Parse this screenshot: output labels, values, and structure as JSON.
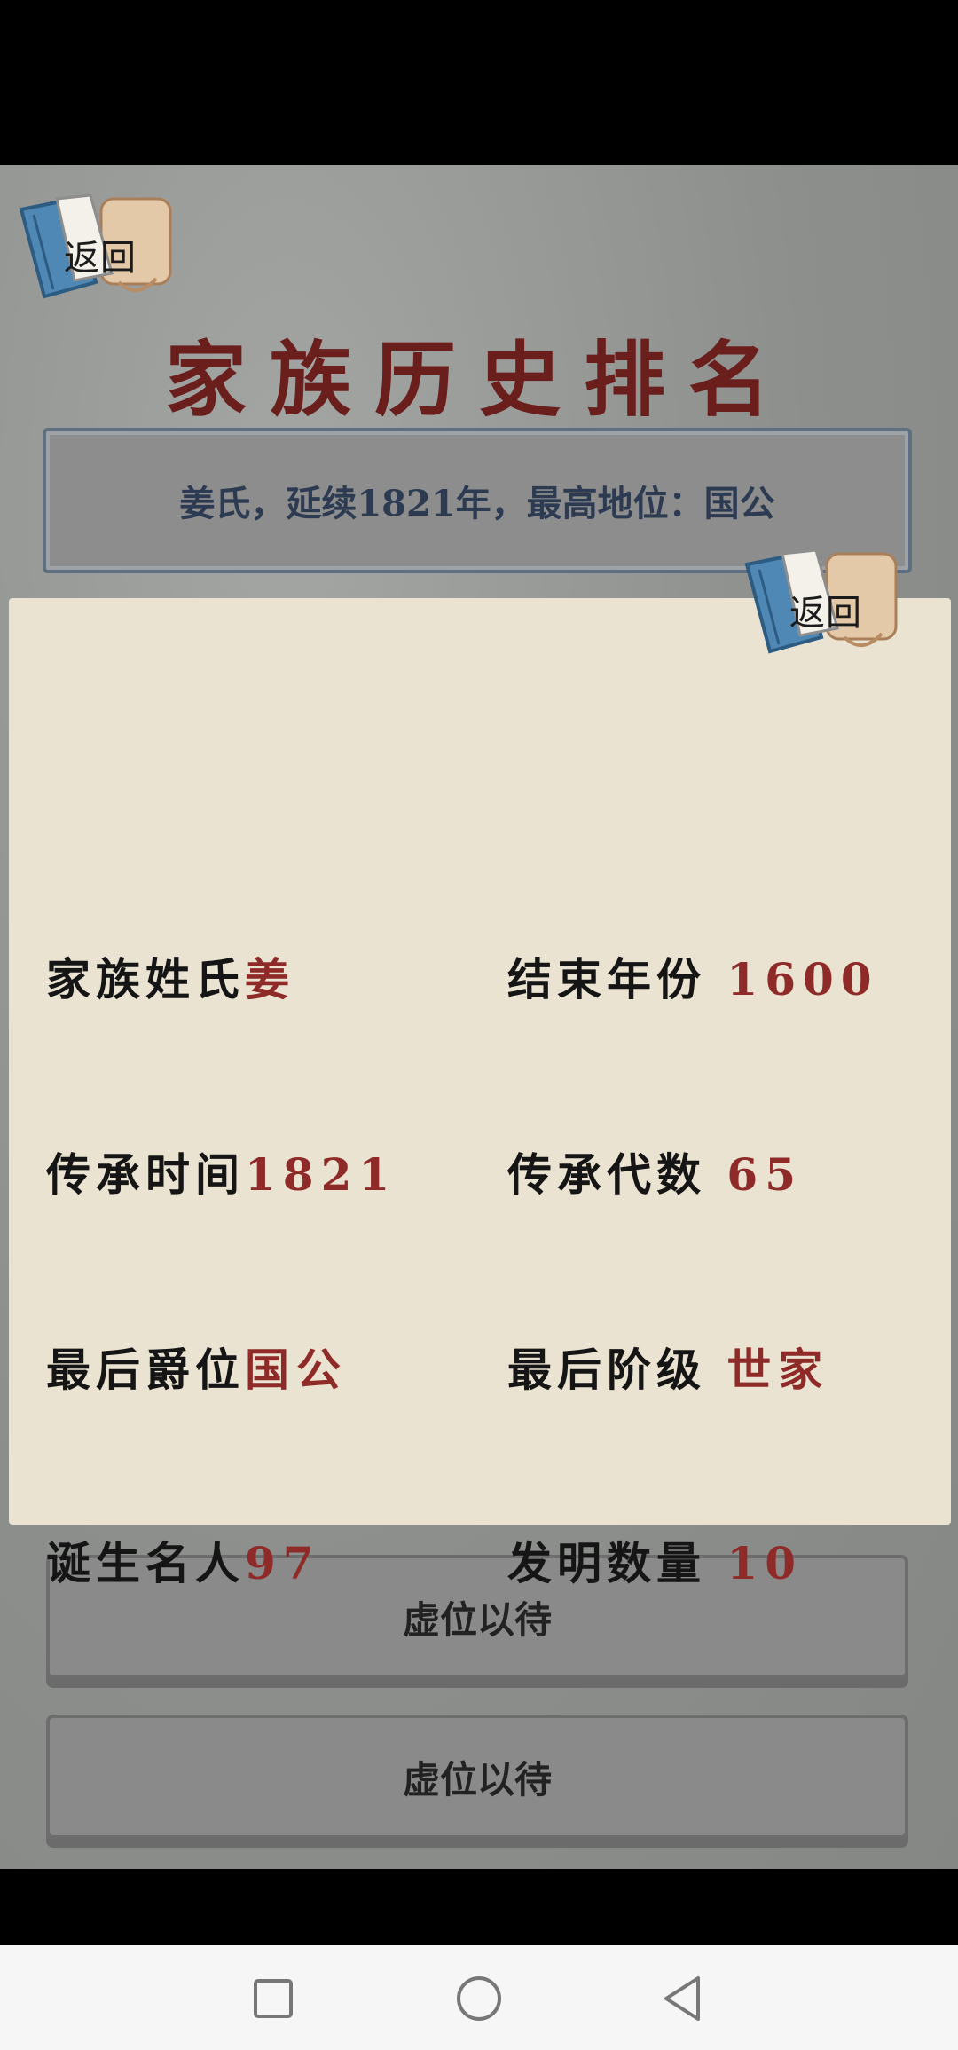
{
  "header": {
    "back_label": "返回",
    "title": "家族历史排名"
  },
  "summary": "姜氏，延续1821年，最高地位：国公",
  "detail_popup": {
    "back_label": "返回",
    "stats": [
      {
        "label": "家族姓氏",
        "value": "姜"
      },
      {
        "label": "结束年份",
        "value": "1600"
      },
      {
        "label": "传承时间",
        "value": "1821"
      },
      {
        "label": "传承代数",
        "value": "65"
      },
      {
        "label": "最后爵位",
        "value": "国公"
      },
      {
        "label": "最后阶级",
        "value": "世家"
      },
      {
        "label": "诞生名人",
        "value": "97"
      },
      {
        "label": "发明数量",
        "value": "10"
      }
    ]
  },
  "ranking_list": [
    {
      "label": "虚位以待"
    },
    {
      "label": "虚位以待"
    }
  ],
  "nav": {
    "recents_icon": "square-icon",
    "home_icon": "circle-icon",
    "back_icon": "triangle-back-icon"
  },
  "colors": {
    "title": "#6a1f1d",
    "value_red": "#8e2b29",
    "parchment": "#ebe3d1"
  }
}
